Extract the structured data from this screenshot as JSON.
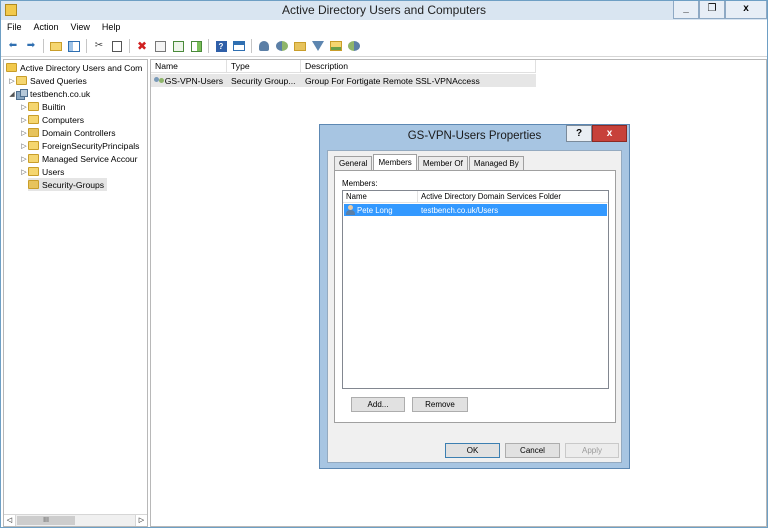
{
  "window": {
    "title": "Active Directory Users and Computers",
    "minimize": "_",
    "restore": "❐",
    "close": "x"
  },
  "menu": [
    "File",
    "Action",
    "View",
    "Help"
  ],
  "toolbar_icons": [
    "back-arrow-icon",
    "forward-arrow-icon",
    "up-folder-icon",
    "show-tree-icon",
    "cut-icon",
    "copy-icon",
    "delete-icon",
    "properties-icon",
    "refresh-icon",
    "export-icon",
    "help-icon",
    "console-icon",
    "new-user-icon",
    "new-group-icon",
    "new-ou-icon",
    "filter-icon",
    "add-to-group-icon",
    "delegate-icon"
  ],
  "tree": {
    "root": "Active Directory Users and Com",
    "saved_queries": "Saved Queries",
    "domain": "testbench.co.uk",
    "children": [
      "Builtin",
      "Computers",
      "Domain Controllers",
      "ForeignSecurityPrincipals",
      "Managed Service Accour",
      "Users",
      "Security-Groups"
    ],
    "scroll_thumb": "III"
  },
  "list": {
    "columns": [
      "Name",
      "Type",
      "Description"
    ],
    "rows": [
      {
        "name": "GS-VPN-Users",
        "type": "Security Group...",
        "description": "Group For Fortigate Remote SSL-VPNAccess"
      }
    ]
  },
  "dialog": {
    "title": "GS-VPN-Users Properties",
    "help": "?",
    "close": "x",
    "tabs": [
      "General",
      "Members",
      "Member Of",
      "Managed By"
    ],
    "active_tab": "Members",
    "members_label": "Members:",
    "columns": [
      "Name",
      "Active Directory Domain Services Folder"
    ],
    "members": [
      {
        "name": "Pete Long",
        "folder": "testbench.co.uk/Users"
      }
    ],
    "add_button": "Add...",
    "remove_button": "Remove",
    "ok_button": "OK",
    "cancel_button": "Cancel",
    "apply_button": "Apply"
  },
  "colors": {
    "dialog_frame": "#a7c5e2",
    "selection": "#3399ff",
    "close_button": "#c7413a"
  }
}
